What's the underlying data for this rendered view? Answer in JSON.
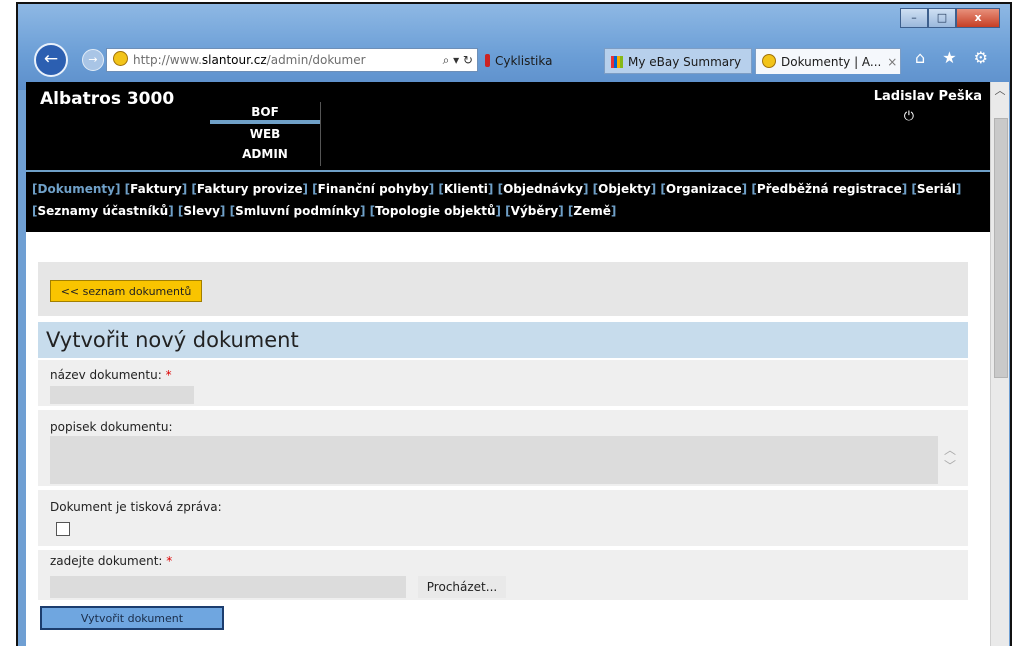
{
  "browser": {
    "window_buttons": {
      "minimize": "–",
      "maximize": "□",
      "close": "x"
    },
    "back_arrow": "←",
    "forward_arrow": "→",
    "address": {
      "prefix": "http://www.",
      "domain": "slantour.cz",
      "path": "/admin/dokumer",
      "controls": "⌕ ▾ ↻"
    },
    "tabs": [
      {
        "label": "Cyklistika",
        "icon": "cyclist-icon"
      },
      {
        "label": "My eBay Summary",
        "icon": "ebay-icon"
      },
      {
        "label": "Dokumenty | A...",
        "icon": "site-favicon",
        "close": "×"
      }
    ],
    "toolbar_icons": "⌂ ★ ⚙"
  },
  "header": {
    "brand": "Albatros 3000",
    "systems": [
      "BOF",
      "WEB",
      "ADMIN"
    ],
    "user": "Ladislav Peška",
    "logout_icon": "⏻"
  },
  "menu": [
    "Dokumenty",
    "Faktury",
    "Faktury provize",
    "Finanční pohyby",
    "Klienti",
    "Objednávky",
    "Objekty",
    "Organizace",
    "Předběžná registrace",
    "Seriál",
    "Seznamy účastníků",
    "Slevy",
    "Smluvní podmínky",
    "Topologie objektů",
    "Výběry",
    "Země"
  ],
  "content": {
    "list_button": "<< seznam dokumentů",
    "form_title": "Vytvořit nový dokument",
    "name_label": "název dokumentu:",
    "desc_label": "popisek dokumentu:",
    "press_label": "Dokument je tisková zpráva:",
    "file_label": "zadejte dokument:",
    "required_mark": "*",
    "browse_button": "Procházet...",
    "submit_button": "Vytvořit dokument"
  }
}
